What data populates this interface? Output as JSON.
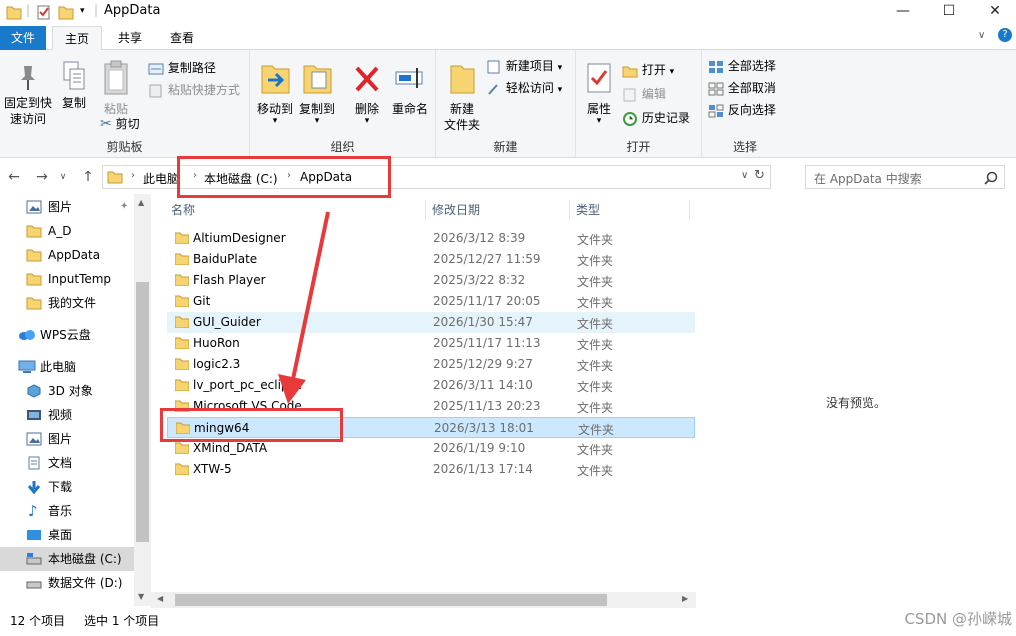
{
  "window": {
    "title": "AppData",
    "controls": [
      "minimize-icon",
      "maximize-icon",
      "close-icon"
    ]
  },
  "menu": {
    "file": "文件",
    "tabs": [
      "主页",
      "共享",
      "查看"
    ],
    "active_tab": "主页"
  },
  "ribbon": {
    "clipboard": {
      "label": "剪贴板",
      "pin": "固定到快\n速访问",
      "pin_l1": "固定到快",
      "pin_l2": "速访问",
      "copy": "复制",
      "paste": "粘贴",
      "copy_path": "复制路径",
      "paste_shortcut": "粘贴快捷方式",
      "cut": "剪切"
    },
    "organize": {
      "label": "组织",
      "move_to": "移动到",
      "copy_to": "复制到",
      "delete": "删除",
      "rename": "重命名"
    },
    "new": {
      "label": "新建",
      "new_folder_l1": "新建",
      "new_folder_l2": "文件夹",
      "new_item": "新建项目",
      "easy_access": "轻松访问"
    },
    "open": {
      "label": "打开",
      "properties": "属性",
      "open": "打开",
      "edit": "编辑",
      "history": "历史记录"
    },
    "select": {
      "label": "选择",
      "select_all": "全部选择",
      "select_none": "全部取消",
      "invert": "反向选择"
    }
  },
  "address": {
    "crumbs": [
      "此电脑",
      "本地磁盘 (C:)",
      "AppData"
    ],
    "search_placeholder": "在 AppData 中搜索"
  },
  "sidebar": {
    "items": [
      {
        "label": "图片",
        "icon": "pictures-icon",
        "pinned": true
      },
      {
        "label": "A_D",
        "icon": "folder-icon"
      },
      {
        "label": "AppData",
        "icon": "folder-icon"
      },
      {
        "label": "InputTemp",
        "icon": "folder-icon"
      },
      {
        "label": "我的文件",
        "icon": "folder-icon"
      },
      {
        "label": "WPS云盘",
        "icon": "cloud-icon"
      },
      {
        "label": "此电脑",
        "icon": "computer-icon"
      },
      {
        "label": "3D 对象",
        "icon": "3d-objects-icon"
      },
      {
        "label": "视频",
        "icon": "video-icon"
      },
      {
        "label": "图片",
        "icon": "pictures-icon"
      },
      {
        "label": "文档",
        "icon": "documents-icon"
      },
      {
        "label": "下载",
        "icon": "download-icon"
      },
      {
        "label": "音乐",
        "icon": "music-icon"
      },
      {
        "label": "桌面",
        "icon": "desktop-icon"
      },
      {
        "label": "本地磁盘 (C:)",
        "icon": "drive-icon",
        "selected": true
      },
      {
        "label": "数据文件 (D:)",
        "icon": "drive-icon"
      }
    ]
  },
  "columns": {
    "name": "名称",
    "date": "修改日期",
    "type": "类型"
  },
  "files": [
    {
      "name": "AltiumDesigner",
      "date": "2026/3/12 8:39",
      "type": "文件夹"
    },
    {
      "name": "BaiduPlate",
      "date": "2025/12/27 11:59",
      "type": "文件夹"
    },
    {
      "name": "Flash Player",
      "date": "2025/3/22 8:32",
      "type": "文件夹"
    },
    {
      "name": "Git",
      "date": "2025/11/17 20:05",
      "type": "文件夹"
    },
    {
      "name": "GUI_Guider",
      "date": "2026/1/30 15:47",
      "type": "文件夹",
      "hover": true
    },
    {
      "name": "HuoRon",
      "date": "2025/11/17 11:13",
      "type": "文件夹"
    },
    {
      "name": "logic2.3",
      "date": "2025/12/29 9:27",
      "type": "文件夹"
    },
    {
      "name": "lv_port_pc_eclipse",
      "date": "2026/3/11 14:10",
      "type": "文件夹"
    },
    {
      "name": "Microsoft VS Code",
      "date": "2025/11/13 20:23",
      "type": "文件夹"
    },
    {
      "name": "mingw64",
      "date": "2026/3/13 18:01",
      "type": "文件夹",
      "selected": true
    },
    {
      "name": "XMind_DATA",
      "date": "2026/1/19 9:10",
      "type": "文件夹"
    },
    {
      "name": "XTW-5",
      "date": "2026/1/13 17:14",
      "type": "文件夹"
    }
  ],
  "preview": {
    "text": "没有预览。"
  },
  "status": {
    "count": "12 个项目",
    "selected": "选中 1 个项目"
  },
  "watermark": "CSDN @孙嵘城",
  "colors": {
    "accent": "#1979ca",
    "annotation_red": "#e8393b",
    "selection_bg": "#cce8ff",
    "folder_yellow": "#f7d472"
  }
}
